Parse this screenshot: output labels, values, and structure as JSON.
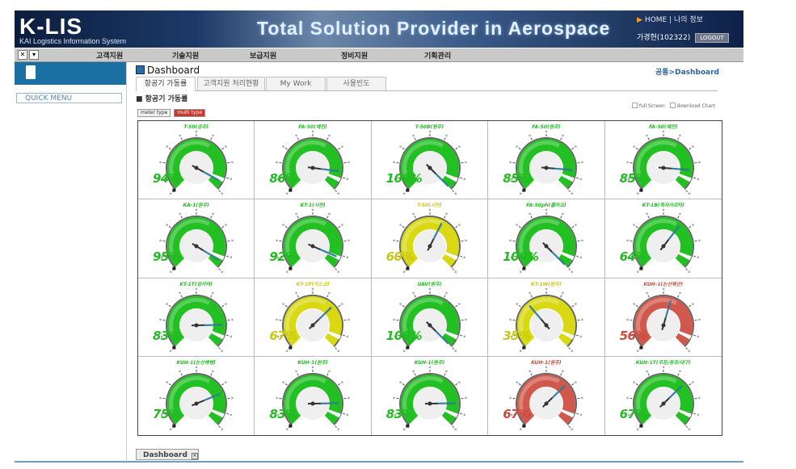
{
  "header": {
    "logo": "K-LIS",
    "logo_sub": "KAI Logistics Information System",
    "slogan": "Total Solution Provider in Aerospace",
    "links": "HOME | 나의 정보",
    "user": "가경현(102322)",
    "logout": "LOGOUT"
  },
  "nav": {
    "items": [
      "고객지원",
      "기술지원",
      "보급지원",
      "정비지원",
      "기획관리"
    ]
  },
  "sidebar": {
    "quick_menu": "QUICK MENU"
  },
  "page": {
    "title": "Dashboard",
    "breadcrumb": "공통>Dashboard",
    "section_title": "■ 항공기 가동률",
    "type_meter": "meter type",
    "type_multi": "multi type",
    "full_screen": "full Screen",
    "download_chart": "download Chart",
    "footer_tab": "Dashboard"
  },
  "tabs": [
    "항공기 가동률",
    "고객지원 처리현황",
    "My Work",
    "사용빈도"
  ],
  "active_tab": 0,
  "colors": {
    "green": "#22c022",
    "yellow": "#d8d813",
    "red": "#d0584c",
    "accent_blue": "#1a6fa3"
  },
  "gauges": [
    {
      "label": "T-50(공주)",
      "value": 94,
      "color": "green"
    },
    {
      "label": "FA-50(예천)",
      "value": 86,
      "color": "green"
    },
    {
      "label": "T-50B(원주)",
      "value": 100,
      "color": "green"
    },
    {
      "label": "FA-50(원주)",
      "value": 85,
      "color": "green"
    },
    {
      "label": "FA-50(예천)",
      "value": 85,
      "color": "green"
    },
    {
      "label": "KA-1(원주)",
      "value": 95,
      "color": "green"
    },
    {
      "label": "KT-1(사천)",
      "value": 92,
      "color": "green"
    },
    {
      "label": "T-50(사천)",
      "value": 60,
      "color": "yellow"
    },
    {
      "label": "FA-50ph(클라크)",
      "value": 100,
      "color": "green"
    },
    {
      "label": "KT-1B(족자카르타)",
      "value": 64,
      "color": "green"
    },
    {
      "label": "KT-1T(앙카라)",
      "value": 83,
      "color": "green"
    },
    {
      "label": "KT-1P(익스코)",
      "value": 67,
      "color": "yellow"
    },
    {
      "label": "UAV(원주)",
      "value": 100,
      "color": "green"
    },
    {
      "label": "KT-1W(원주)",
      "value": 35,
      "color": "yellow"
    },
    {
      "label": "KUH-1(논산육군)",
      "value": 56,
      "color": "red"
    },
    {
      "label": "KUH-1(논산해병)",
      "value": 75,
      "color": "green"
    },
    {
      "label": "KUH-1(원주)",
      "value": 83,
      "color": "green"
    },
    {
      "label": "KUH-1(원주)",
      "value": 83,
      "color": "green"
    },
    {
      "label": "KUH-1(원주)",
      "value": 67,
      "color": "red"
    },
    {
      "label": "KUH-1T(주둔/광주/대구)",
      "value": 67,
      "color": "green"
    }
  ]
}
